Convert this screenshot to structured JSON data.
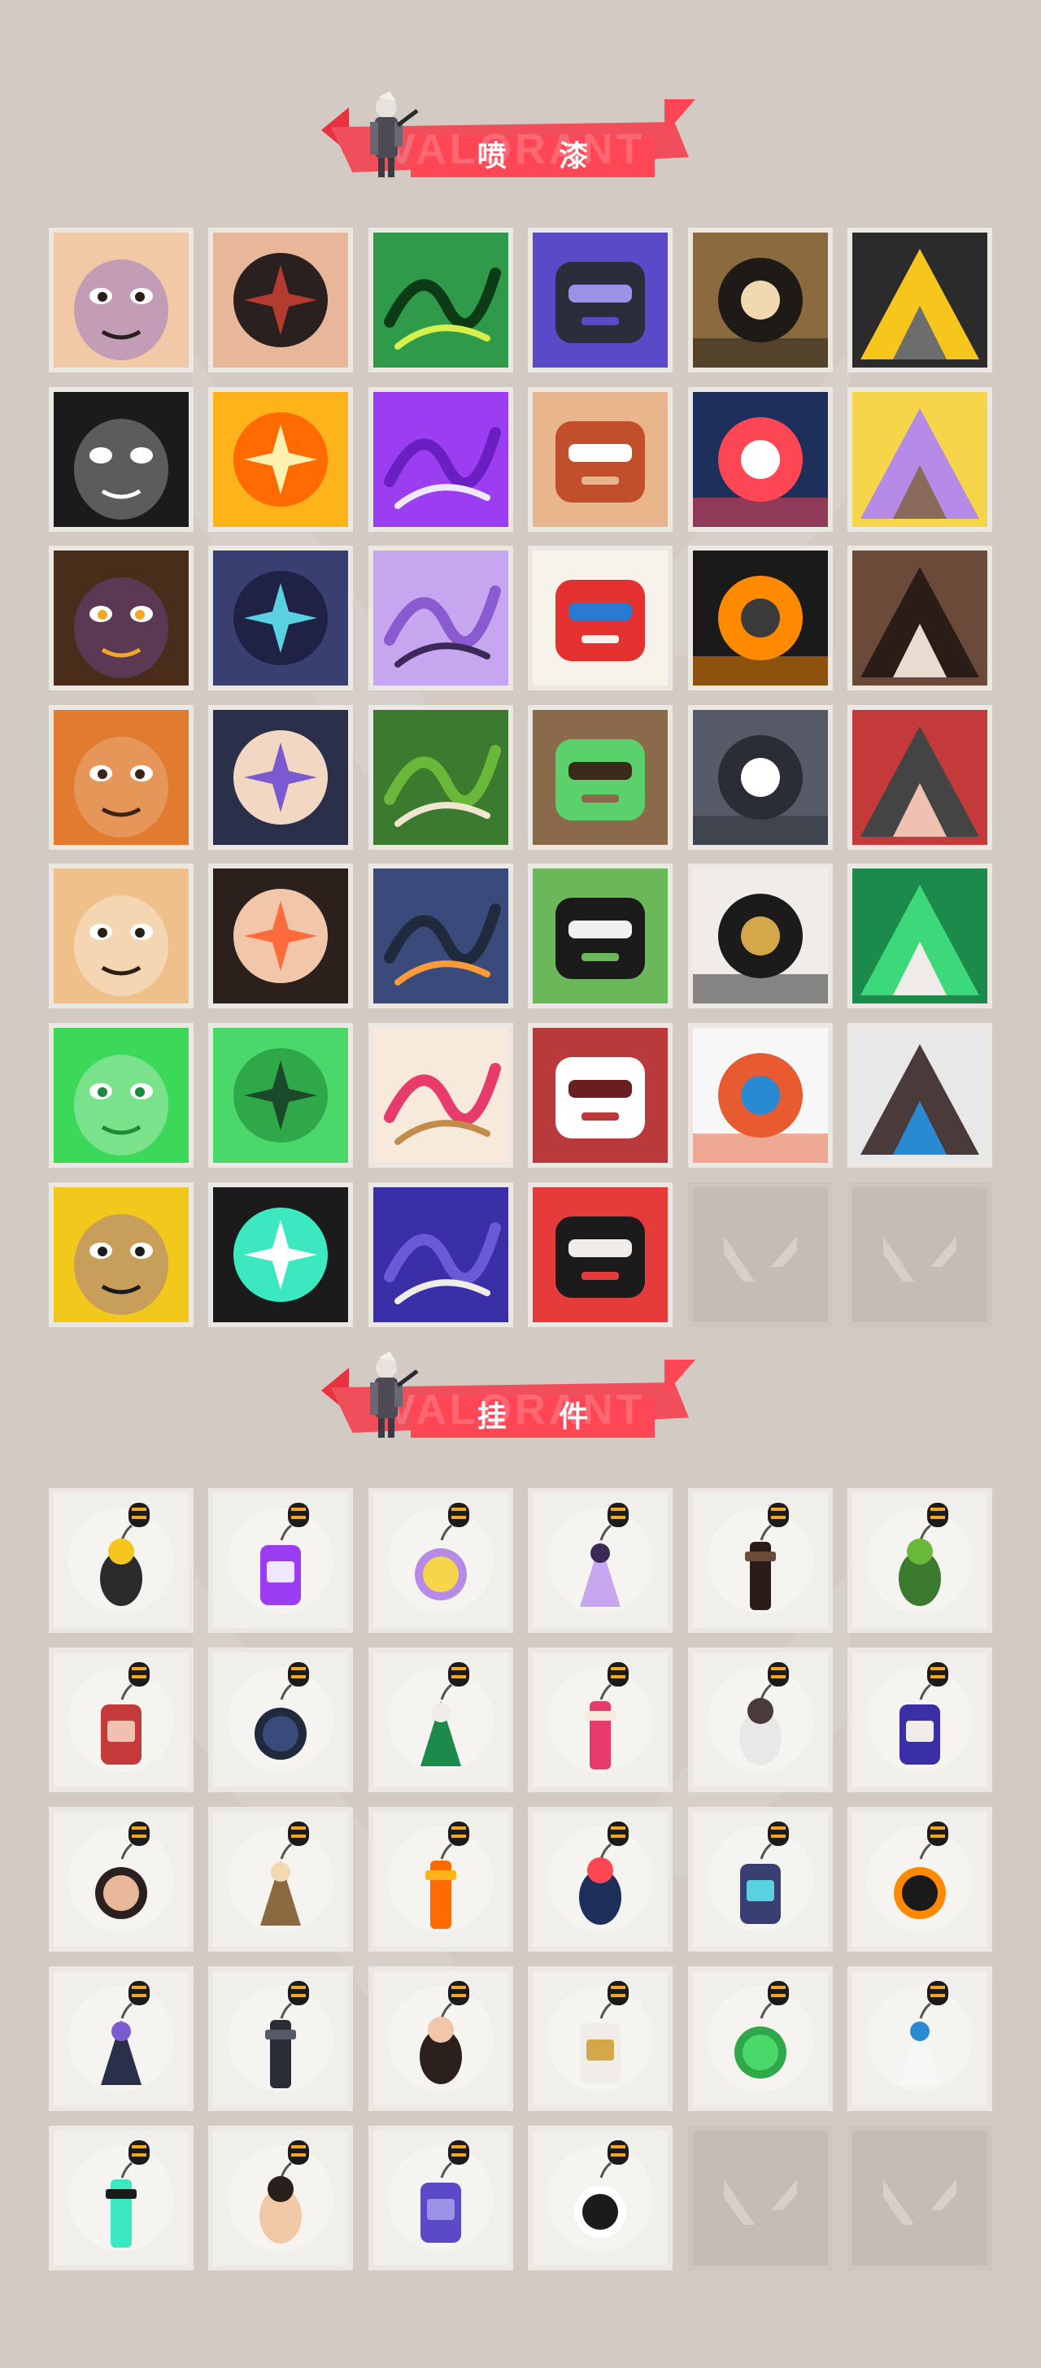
{
  "brand": {
    "watermark": "VALORANT",
    "accent": "#ff4655"
  },
  "sections": {
    "sprays": {
      "title": "喷 漆"
    },
    "charms": {
      "title": "挂 件"
    }
  },
  "sprays": [
    {
      "icon": "girl-crying-butterfly-spray-icon"
    },
    {
      "icon": "angry-man-face-spray-icon"
    },
    {
      "icon": "green-robot-helmet-spray-icon"
    },
    {
      "icon": "purple-mech-arm-spray-icon"
    },
    {
      "icon": "penguin-beanie-spray-icon"
    },
    {
      "icon": "camera-drone-spray-icon"
    },
    {
      "icon": "sparkle-emblem-spray-icon"
    },
    {
      "icon": "golden-mask-spray-icon"
    },
    {
      "icon": "purple-graffiti-tag-spray-icon"
    },
    {
      "icon": "goggles-cat-spray-icon"
    },
    {
      "icon": "chevron-logo-spray-icon"
    },
    {
      "icon": "unicorn-horn-spray-icon"
    },
    {
      "icon": "pixel-agent-spray-icon"
    },
    {
      "icon": "armored-helmet-spray-icon"
    },
    {
      "icon": "purple-ghost-face-spray-icon"
    },
    {
      "icon": "clown-face-spray-icon"
    },
    {
      "icon": "orange-dial-spray-icon"
    },
    {
      "icon": "raccoon-sunglasses-spray-icon"
    },
    {
      "icon": "bearded-warrior-spray-icon"
    },
    {
      "icon": "anime-boy-spray-icon"
    },
    {
      "icon": "green-crate-spray-icon"
    },
    {
      "icon": "glowing-eyes-creature-spray-icon"
    },
    {
      "icon": "crying-seal-spray-icon"
    },
    {
      "icon": "bacon-strip-spray-icon"
    },
    {
      "icon": "tiger-face-spray-icon"
    },
    {
      "icon": "girl-pencil-spray-icon"
    },
    {
      "icon": "penguin-scarf-spray-icon"
    },
    {
      "icon": "frog-top-hat-spray-icon"
    },
    {
      "icon": "silhouette-portrait-spray-icon"
    },
    {
      "icon": "viper-green-text-spray-icon"
    },
    {
      "icon": "green-snake-spray-icon"
    },
    {
      "icon": "green-smoke-orb-spray-icon"
    },
    {
      "icon": "heart-hands-spray-icon"
    },
    {
      "icon": "red-x-button-spray-icon"
    },
    {
      "icon": "koi-fish-orange-spray-icon"
    },
    {
      "icon": "koi-fish-gray-spray-icon"
    },
    {
      "icon": "pistol-masked-agent-spray-icon"
    },
    {
      "icon": "valorant-logo-teal-spray-icon"
    },
    {
      "icon": "purple-drip-graffiti-spray-icon"
    },
    {
      "icon": "red-valorant-circle-spray-icon"
    },
    {
      "icon": "empty-slot"
    },
    {
      "icon": "empty-slot"
    }
  ],
  "charms": [
    {
      "icon": "golden-bear-charm-icon"
    },
    {
      "icon": "drone-bot-charm-icon"
    },
    {
      "icon": "toaster-charm-icon"
    },
    {
      "icon": "armored-cat-charm-icon"
    },
    {
      "icon": "round-bag-charm-icon"
    },
    {
      "icon": "blue-canister-charm-icon"
    },
    {
      "icon": "spiked-club-charm-icon"
    },
    {
      "icon": "orange-pepper-charm-icon"
    },
    {
      "icon": "braided-cord-charm-icon"
    },
    {
      "icon": "cupcake-charm-icon"
    },
    {
      "icon": "ep9-medal-charm-icon"
    },
    {
      "icon": "teddy-bear-charm-icon"
    },
    {
      "icon": "wooden-turret-charm-icon"
    },
    {
      "icon": "robot-figure-charm-icon"
    },
    {
      "icon": "cardboard-box-charm-icon"
    },
    {
      "icon": "trumpet-robot-charm-icon"
    },
    {
      "icon": "lava-lamp-charm-icon"
    },
    {
      "icon": "green-pager-charm-icon"
    },
    {
      "icon": "sneaker-charm-icon"
    },
    {
      "icon": "astronaut-charm-icon"
    },
    {
      "icon": "radio-charm-icon"
    },
    {
      "icon": "ep9-purple-medal-charm-icon"
    },
    {
      "icon": "pixel-heart-charm-icon"
    },
    {
      "icon": "soda-can-charm-icon"
    },
    {
      "icon": "green-lantern-charm-icon"
    },
    {
      "icon": "ufo-charm-icon"
    },
    {
      "icon": "gray-cat-charm-icon"
    },
    {
      "icon": "black-tag-charm-icon"
    },
    {
      "icon": "empty-slot"
    },
    {
      "icon": "empty-slot"
    }
  ]
}
